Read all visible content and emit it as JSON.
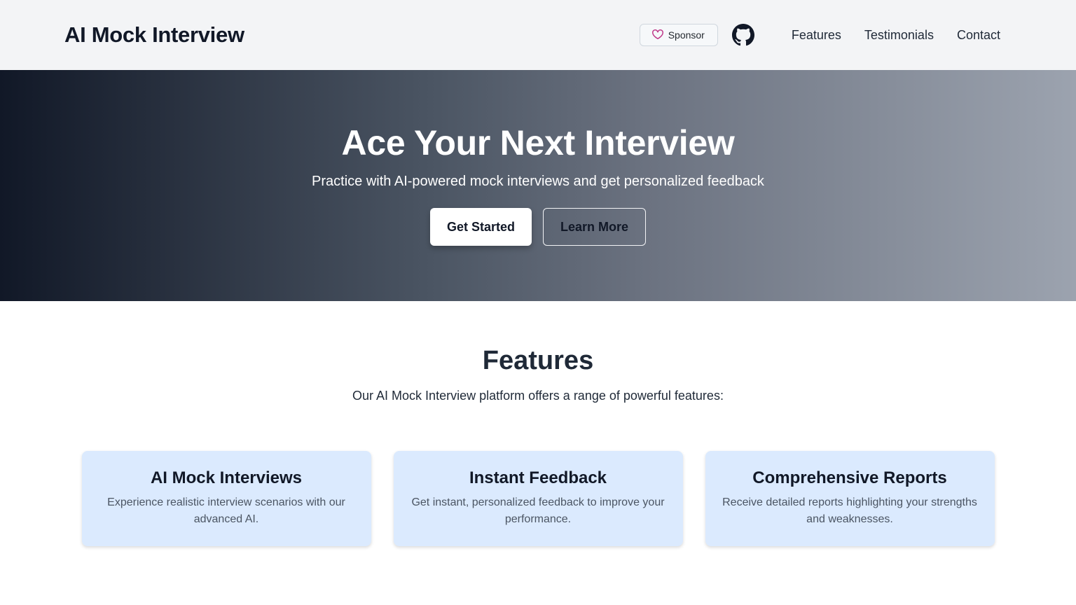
{
  "navbar": {
    "brand": "AI Mock Interview",
    "sponsor_label": "Sponsor",
    "github_icon": "github-icon",
    "links": [
      "Features",
      "Testimonials",
      "Contact"
    ]
  },
  "hero": {
    "title": "Ace Your Next Interview",
    "subtitle": "Practice with AI-powered mock interviews and get personalized feedback",
    "primary_button": "Get Started",
    "secondary_button": "Learn More"
  },
  "features": {
    "title": "Features",
    "subtitle": "Our AI Mock Interview platform offers a range of powerful features:",
    "cards": [
      {
        "title": "AI Mock Interviews",
        "description": "Experience realistic interview scenarios with our advanced AI."
      },
      {
        "title": "Instant Feedback",
        "description": "Get instant, personalized feedback to improve your performance."
      },
      {
        "title": "Comprehensive Reports",
        "description": "Receive detailed reports highlighting your strengths and weaknesses."
      }
    ]
  },
  "colors": {
    "navbar_bg": "#f3f4f6",
    "card_bg": "#dbeafe",
    "sponsor_heart": "#bf3989"
  }
}
